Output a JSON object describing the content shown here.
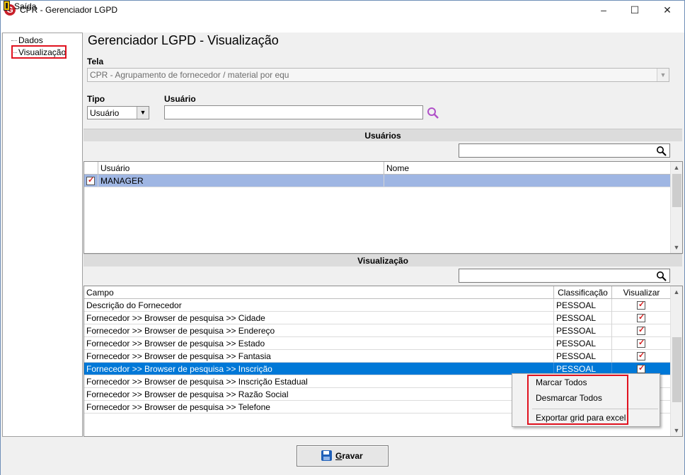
{
  "window": {
    "title": "CPR - Gerenciador LGPD",
    "logo": "G",
    "controls": {
      "minimize": "–",
      "maximize": "☐",
      "close": "✕"
    }
  },
  "menu": {
    "exit": "Saída"
  },
  "tree": {
    "items": [
      {
        "label": "Dados"
      },
      {
        "label": "Visualização"
      }
    ]
  },
  "main": {
    "title": "Gerenciador LGPD - Visualização",
    "tela": {
      "label": "Tela",
      "value": "CPR - Agrupamento de fornecedor / material por equ"
    },
    "tipo": {
      "label": "Tipo",
      "value": "Usuário"
    },
    "usuario": {
      "label": "Usuário",
      "value": ""
    }
  },
  "usuarios_section": {
    "title": "Usuários",
    "search_value": "",
    "columns": [
      "Usuário",
      "Nome"
    ],
    "rows": [
      {
        "checked": true,
        "usuario": "MANAGER",
        "nome": ""
      }
    ]
  },
  "visualizacao_section": {
    "title": "Visualização",
    "search_value": "",
    "columns": [
      "Campo",
      "Classificação",
      "Visualizar"
    ],
    "rows": [
      {
        "campo": "Descrição do Fornecedor",
        "classificacao": "PESSOAL",
        "visualizar": true
      },
      {
        "campo": "Fornecedor >> Browser de pesquisa >> Cidade",
        "classificacao": "PESSOAL",
        "visualizar": true
      },
      {
        "campo": "Fornecedor >> Browser de pesquisa >> Endereço",
        "classificacao": "PESSOAL",
        "visualizar": true
      },
      {
        "campo": "Fornecedor >> Browser de pesquisa >> Estado",
        "classificacao": "PESSOAL",
        "visualizar": true
      },
      {
        "campo": "Fornecedor >> Browser de pesquisa >> Fantasia",
        "classificacao": "PESSOAL",
        "visualizar": true
      },
      {
        "campo": "Fornecedor >> Browser de pesquisa >> Inscrição",
        "classificacao": "PESSOAL",
        "visualizar": true
      },
      {
        "campo": "Fornecedor >> Browser de pesquisa >> Inscrição Estadual",
        "classificacao": "",
        "visualizar": false
      },
      {
        "campo": "Fornecedor >> Browser de pesquisa >> Razão Social",
        "classificacao": "",
        "visualizar": false
      },
      {
        "campo": "Fornecedor >> Browser de pesquisa >> Telefone",
        "classificacao": "",
        "visualizar": false
      }
    ],
    "selected_row": 5
  },
  "context_menu": {
    "items": [
      "Marcar Todos",
      "Desmarcar Todos",
      "Exportar grid para excel"
    ]
  },
  "footer": {
    "save_label": "Gravar",
    "save_mnemonic": "G",
    "save_rest": "ravar"
  },
  "colors": {
    "selection_blue": "#0078d7",
    "user_row_blue": "#9fb6e3",
    "highlight_red": "#e0121f"
  }
}
